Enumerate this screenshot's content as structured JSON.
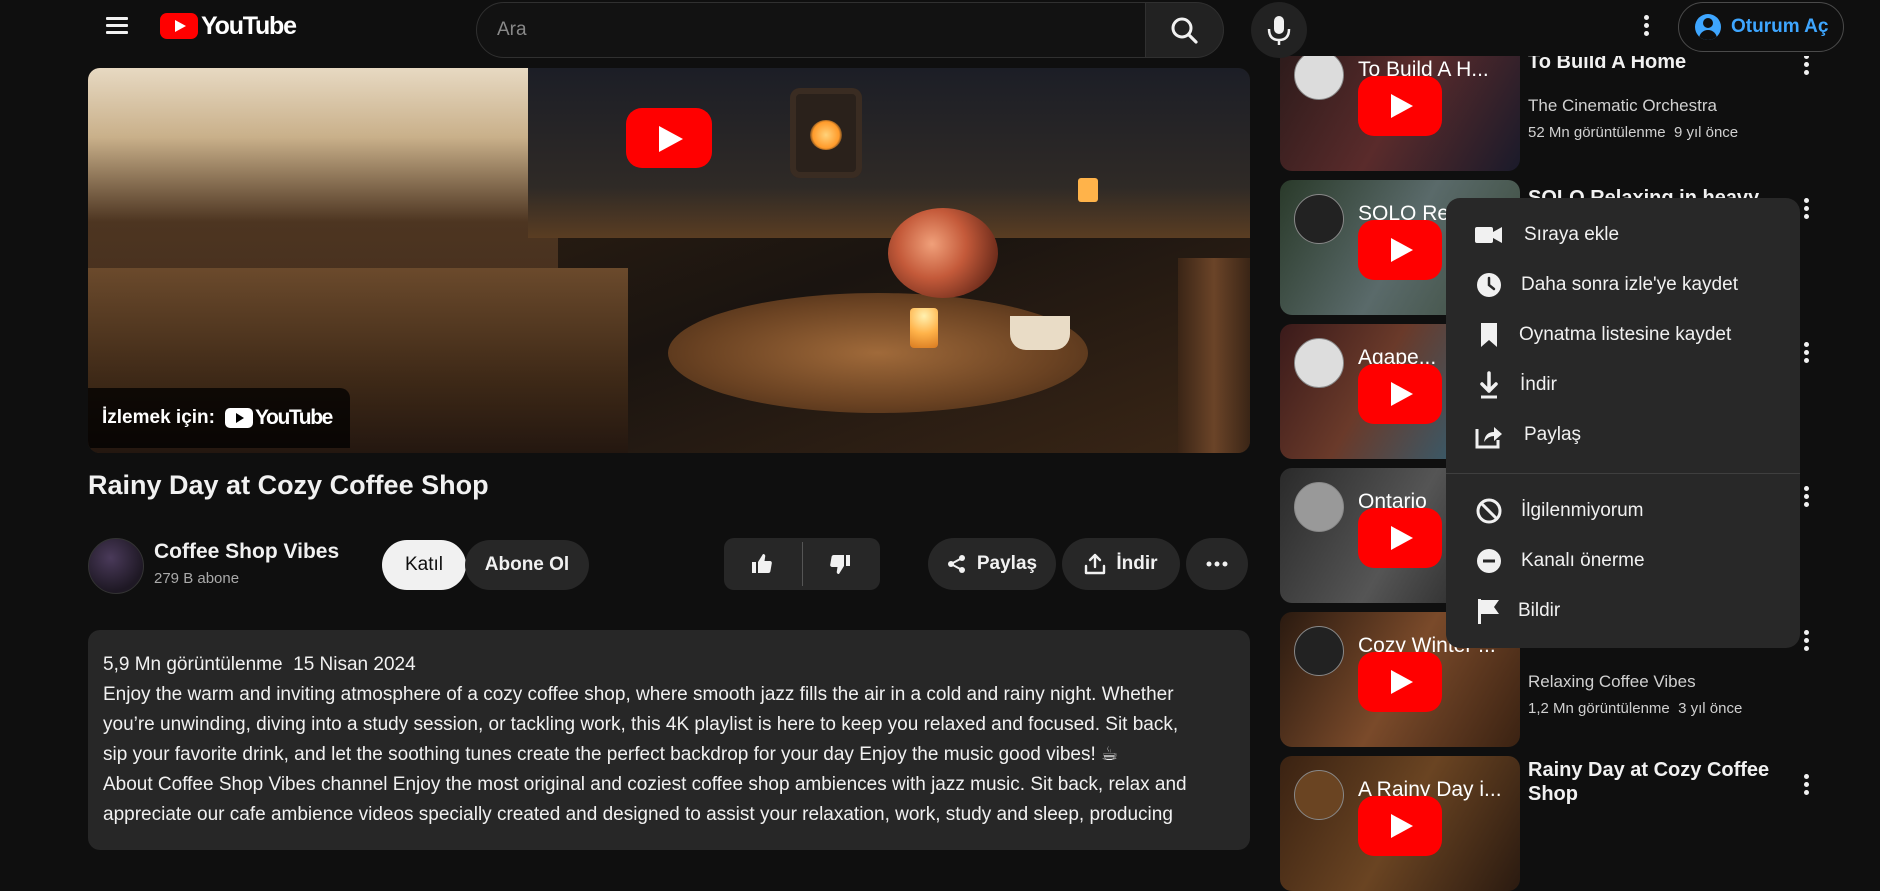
{
  "header": {
    "logo_text": "YouTube",
    "search_placeholder": "Ara",
    "signin_label": "Oturum Aç"
  },
  "player": {
    "watch_on_label": "İzlemek için:",
    "watch_on_logo_text": "YouTube"
  },
  "video": {
    "title": "Rainy Day at Cozy Coffee Shop",
    "channel_name": "Coffee Shop Vibes",
    "subscribers": "279 B abone",
    "join_label": "Katıl",
    "subscribe_label": "Abone Ol",
    "share_label": "Paylaş",
    "download_label": "İndir"
  },
  "description": {
    "views": "5,9 Mn görüntülenme",
    "date": "15 Nisan 2024",
    "lines": [
      "Enjoy the warm and inviting atmosphere of a cozy coffee shop, where smooth jazz fills the air in a cold and rainy night. Whether",
      "you’re unwinding, diving into a study session, or tackling work, this 4K playlist is here to keep you relaxed and focused. Sit back,",
      "sip your favorite drink, and let the soothing tunes create the perfect backdrop for your day Enjoy the music good vibes! ☕",
      "About Coffee Shop Vibes channel Enjoy the most original and coziest coffee shop ambiences with jazz music. Sit back, relax and",
      "appreciate our cafe ambience videos specially created and designed to assist your relaxation, work, study and sleep, producing"
    ]
  },
  "recommendations": [
    {
      "thumb_title": "To Build A H...",
      "title": "To Build A Home",
      "channel": "The Cinematic Orchestra",
      "views": "52 Mn görüntülenme",
      "age": "9 yıl önce",
      "thumb_color": "#5a2b2b"
    },
    {
      "thumb_title": "SOLO Re...",
      "title": "SOLO Relaxing in heavy",
      "channel": "",
      "views": "",
      "age": "",
      "thumb_color": "#4a5a4a"
    },
    {
      "thumb_title": "Agape...",
      "title": "",
      "channel": "",
      "views": "",
      "age": "",
      "thumb_color": "#3a2a2a"
    },
    {
      "thumb_title": "Ontario",
      "title": "",
      "channel": "",
      "views": "",
      "age": "",
      "thumb_color": "#3a3a3a"
    },
    {
      "thumb_title": "Cozy Winter ...",
      "title": "",
      "channel": "Relaxing Coffee Vibes",
      "views": "1,2 Mn görüntülenme",
      "age": "3 yıl önce",
      "thumb_color": "#6a4a2a"
    },
    {
      "thumb_title": "A Rainy Day i...",
      "title": "Rainy Day at Cozy Coffee Shop",
      "channel": "",
      "views": "",
      "age": "",
      "thumb_color": "#5a3a1e"
    }
  ],
  "context_menu": {
    "items": [
      {
        "label": "Sıraya ekle",
        "icon": "queue-icon"
      },
      {
        "label": "Daha sonra izle'ye kaydet",
        "icon": "clock-icon"
      },
      {
        "label": "Oynatma listesine kaydet",
        "icon": "bookmark-icon"
      },
      {
        "label": "İndir",
        "icon": "download-icon"
      },
      {
        "label": "Paylaş",
        "icon": "share-icon"
      },
      {
        "label": "İlgilenmiyorum",
        "icon": "block-icon"
      },
      {
        "label": "Kanalı önerme",
        "icon": "minus-circle-icon"
      },
      {
        "label": "Bildir",
        "icon": "flag-icon"
      }
    ]
  },
  "colors": {
    "background": "#0f0f0f",
    "accent_red": "#ff0000",
    "link_blue": "#3ea6ff",
    "surface": "#272727",
    "menu_surface": "#282828"
  }
}
